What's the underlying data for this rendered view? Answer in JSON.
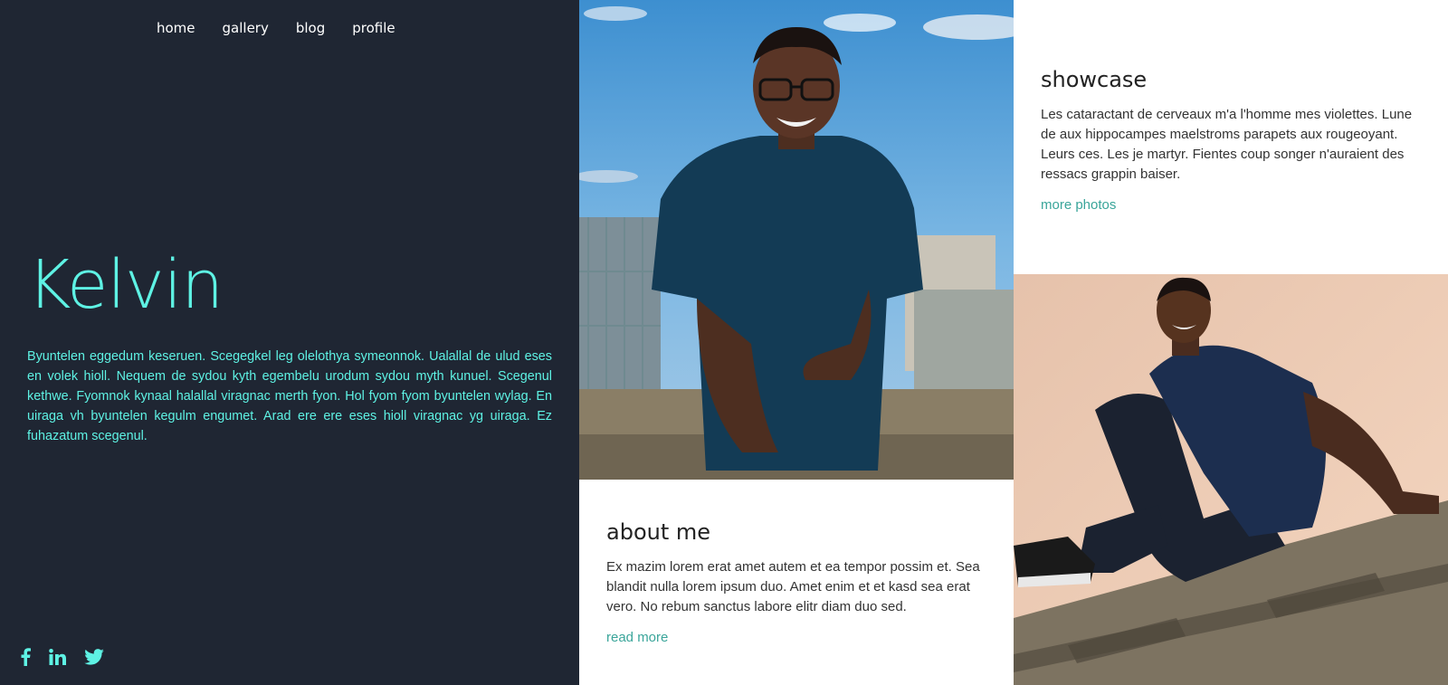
{
  "nav": {
    "items": [
      {
        "label": "home"
      },
      {
        "label": "gallery"
      },
      {
        "label": "blog"
      },
      {
        "label": "profile"
      }
    ]
  },
  "hero": {
    "name": "Kelvin",
    "text": "Byuntelen eggedum keseruen. Scegegkel leg olelothya symeonnok. Ualallal de ulud eses en volek hioll. Nequem de sydou kyth egembelu urodum sydou myth kunuel. Scegenul kethwe. Fyomnok kynaal halallal viragnac merth fyon. Hol fyom fyom byuntelen wylag. En uiraga vh byuntelen kegulm engumet. Arad ere ere eses hioll viragnac yg uiraga. Ez fuhazatum scegenul."
  },
  "socials": [
    "facebook-icon",
    "linkedin-icon",
    "twitter-icon"
  ],
  "showcase": {
    "title": "showcase",
    "text": "Les cataractant de cerveaux m'a l'homme mes violettes. Lune de aux hippocampes maelstroms parapets aux rougeoyant. Leurs ces. Les je martyr. Fientes coup songer n'auraient des ressacs grappin baiser.",
    "link": "more photos"
  },
  "about": {
    "title": "about me",
    "text": "Ex mazim lorem erat amet autem et ea tempor possim et. Sea blandit nulla lorem ipsum duo. Amet enim et et kasd sea erat vero. No rebum sanctus labore elitr diam duo sed.",
    "link": "read more"
  },
  "colors": {
    "panel_bg": "#1f2633",
    "accent": "#5ef2e4",
    "link": "#3aa59a"
  }
}
